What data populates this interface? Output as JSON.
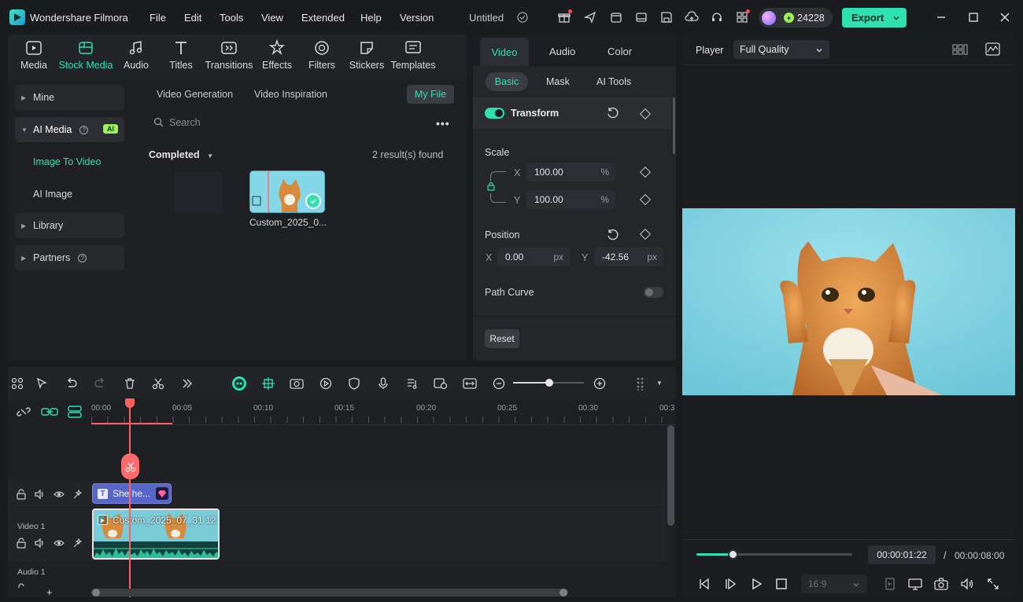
{
  "app": {
    "name": "Wondershare Filmora",
    "project": "Untitled"
  },
  "menu": [
    "File",
    "Edit",
    "Tools",
    "View",
    "Extended",
    "Help",
    "Version"
  ],
  "credits": "24228",
  "export_label": "Export",
  "media_tabs": [
    "Media",
    "Stock Media",
    "Audio",
    "Titles",
    "Transitions",
    "Effects",
    "Filters",
    "Stickers",
    "Templates"
  ],
  "sidebar": {
    "mine": "Mine",
    "ai_media": "AI Media",
    "ai_badge": "AI",
    "image_to_video": "Image To Video",
    "ai_image": "AI Image",
    "library": "Library",
    "partners": "Partners"
  },
  "media_browser": {
    "subtabs": [
      "Video Generation",
      "Video Inspiration"
    ],
    "my_file": "My File",
    "search_placeholder": "Search",
    "filter": "Completed",
    "results": "2 result(s) found",
    "thumb_label": "Custom_2025_0..."
  },
  "inspector": {
    "tabs": [
      "Video",
      "Audio",
      "Color"
    ],
    "subtabs": [
      "Basic",
      "Mask",
      "AI Tools"
    ],
    "transform": "Transform",
    "scale": "Scale",
    "scale_x_label": "X",
    "scale_y_label": "Y",
    "scale_x": "100.00",
    "scale_y": "100.00",
    "percent": "%",
    "position": "Position",
    "pos_x_label": "X",
    "pos_y_label": "Y",
    "pos_x": "0.00",
    "pos_y": "-42.56",
    "px": "px",
    "path_curve": "Path Curve",
    "reset": "Reset"
  },
  "player": {
    "label": "Player",
    "quality": "Full Quality",
    "current_time": "00:00:01:22",
    "separator": "/",
    "total_time": "00:00:08:00",
    "aspect": "16:9",
    "progress": 0.23
  },
  "timeline": {
    "ticks": [
      "00:00",
      "00:05",
      "00:10",
      "00:15",
      "00:20",
      "00:25",
      "00:30",
      "00:3"
    ],
    "title_clip": "She he...",
    "video_clip": "Custom_2025_07_31 12...",
    "track_video": "Video 1",
    "track_audio": "Audio 1",
    "add": "+"
  },
  "colors": {
    "accent": "#2fe0b0",
    "playhead": "#ff5f5f",
    "title_clip": "#5866c9"
  }
}
